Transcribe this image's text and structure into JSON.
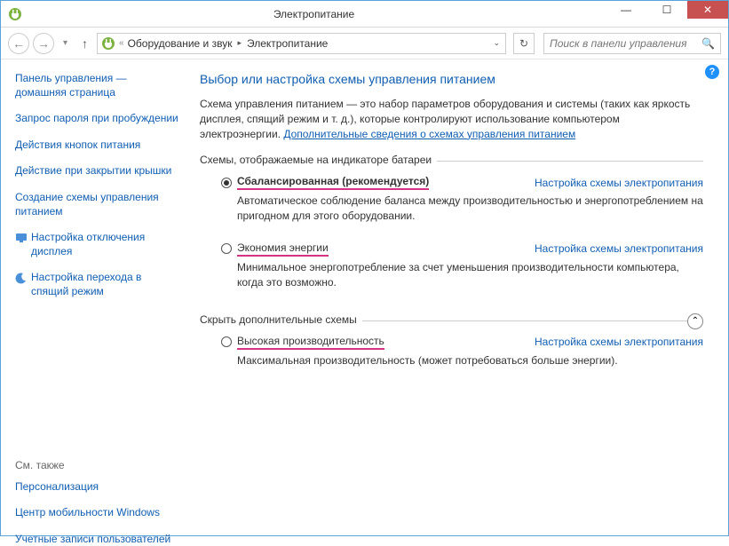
{
  "window": {
    "title": "Электропитание"
  },
  "breadcrumb": {
    "items": [
      "Оборудование и звук",
      "Электропитание"
    ]
  },
  "search": {
    "placeholder": "Поиск в панели управления"
  },
  "sidebar": {
    "home": "Панель управления — домашняя страница",
    "links": [
      "Запрос пароля при пробуждении",
      "Действия кнопок питания",
      "Действие при закрытии крышки",
      "Создание схемы управления питанием"
    ],
    "icon_links": [
      "Настройка отключения дисплея",
      "Настройка перехода в спящий режим"
    ],
    "see_also_label": "См. также",
    "see_also": [
      "Персонализация",
      "Центр мобильности Windows",
      "Учетные записи пользователей"
    ]
  },
  "main": {
    "heading": "Выбор или настройка схемы управления питанием",
    "intro_text": "Схема управления питанием — это набор параметров оборудования и системы (таких как яркость дисплея, спящий режим и т. д.), которые контролируют использование компьютером электроэнергии. ",
    "intro_link": "Дополнительные сведения о схемах управления питанием",
    "section1_legend": "Схемы, отображаемые на индикаторе батареи",
    "section2_legend": "Скрыть дополнительные схемы",
    "change_link": "Настройка схемы электропитания",
    "plans": {
      "balanced": {
        "name": "Сбалансированная (рекомендуется)",
        "desc": "Автоматическое соблюдение баланса между производительностью и энергопотреблением на пригодном для этого оборудовании."
      },
      "saver": {
        "name": "Экономия энергии",
        "desc": "Минимальное энергопотребление за счет уменьшения производительности компьютера, когда это возможно."
      },
      "high": {
        "name": "Высокая производительность",
        "desc": "Максимальная производительность (может потребоваться больше энергии)."
      }
    }
  }
}
